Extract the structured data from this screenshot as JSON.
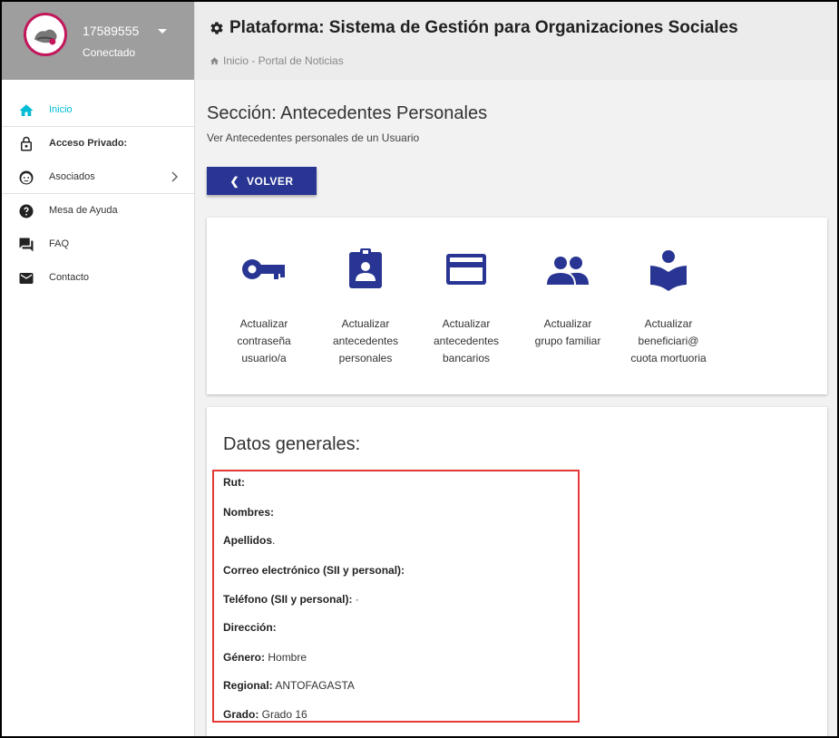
{
  "user": {
    "id": "17589555",
    "status": "Conectado"
  },
  "sidebar": {
    "items": [
      {
        "label": "Inicio",
        "icon": "home-icon"
      },
      {
        "label": "Acceso Privado:",
        "icon": "lock-icon"
      },
      {
        "label": "Asociados",
        "icon": "face-icon"
      },
      {
        "label": "Mesa de Ayuda",
        "icon": "help-icon"
      },
      {
        "label": "FAQ",
        "icon": "forum-icon"
      },
      {
        "label": "Contacto",
        "icon": "mail-icon"
      }
    ]
  },
  "header": {
    "title": "Plataforma: Sistema de Gestión para Organizaciones Sociales",
    "breadcrumb": "Inicio - Portal de Noticias"
  },
  "section": {
    "title": "Sección: Antecedentes Personales",
    "subtitle": "Ver Antecedentes personales de un Usuario",
    "back_label": "VOLVER"
  },
  "actions": [
    {
      "line1": "Actualizar",
      "line2": "contraseña",
      "line3": "usuario/a",
      "icon": "key-icon"
    },
    {
      "line1": "Actualizar",
      "line2": "antecedentes",
      "line3": "personales",
      "icon": "badge-icon"
    },
    {
      "line1": "Actualizar",
      "line2": "antecedentes",
      "line3": "bancarios",
      "icon": "credit-card-icon"
    },
    {
      "line1": "Actualizar",
      "line2": "grupo familiar",
      "line3": "",
      "icon": "people-icon"
    },
    {
      "line1": "Actualizar",
      "line2": "beneficiari@",
      "line3": "cuota mortuoria",
      "icon": "book-reader-icon"
    }
  ],
  "datos": {
    "title": "Datos generales:",
    "fields": [
      {
        "label": "Rut:",
        "value": ""
      },
      {
        "label": "Nombres:",
        "value": ""
      },
      {
        "label": "Apellidos",
        "value": "."
      },
      {
        "label": "Correo electrónico (SII y personal):",
        "value": ""
      },
      {
        "label": "Teléfono (SII y personal):",
        "value": " ·"
      },
      {
        "label": "Dirección:",
        "value": ""
      },
      {
        "label": "Género:",
        "value": " Hombre"
      },
      {
        "label": "Regional:",
        "value": " ANTOFAGASTA"
      },
      {
        "label": "Grado:",
        "value": " Grado 16"
      }
    ]
  },
  "colors": {
    "primary": "#283593",
    "accent": "#00bcd4",
    "highlight": "#e53935"
  }
}
